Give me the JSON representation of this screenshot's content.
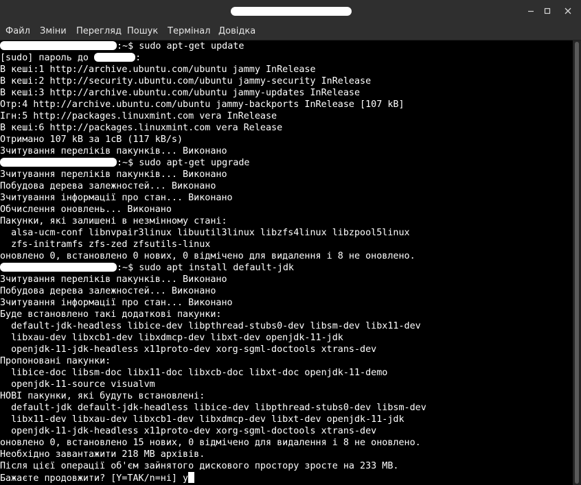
{
  "window": {
    "controls": {
      "minimize": "minimize-icon",
      "maximize": "maximize-icon",
      "close": "close-icon"
    }
  },
  "menu": {
    "items": [
      "Файл",
      "Зміни",
      "Перегляд",
      "Пошук",
      "Термінал",
      "Довідка"
    ]
  },
  "terminal": {
    "prompt_suffix": ":~$ ",
    "lines": [
      {
        "type": "prompt",
        "text": "sudo apt-get update"
      },
      {
        "type": "sudo",
        "before": "[sudo] пароль до ",
        "after": ":"
      },
      {
        "type": "text",
        "text": "В кеші:1 http://archive.ubuntu.com/ubuntu jammy InRelease"
      },
      {
        "type": "text",
        "text": "В кеші:2 http://security.ubuntu.com/ubuntu jammy-security InRelease"
      },
      {
        "type": "text",
        "text": "В кеші:3 http://archive.ubuntu.com/ubuntu jammy-updates InRelease"
      },
      {
        "type": "text",
        "text": "Отр:4 http://archive.ubuntu.com/ubuntu jammy-backports InRelease [107 kB]"
      },
      {
        "type": "text",
        "text": "Ігн:5 http://packages.linuxmint.com vera InRelease"
      },
      {
        "type": "text",
        "text": "В кеші:6 http://packages.linuxmint.com vera Release"
      },
      {
        "type": "text",
        "text": "Отримано 107 kB за 1сВ (117 kB/s)"
      },
      {
        "type": "text",
        "text": "Зчитування переліків пакунків... Виконано"
      },
      {
        "type": "prompt",
        "text": "sudo apt-get upgrade"
      },
      {
        "type": "text",
        "text": "Зчитування переліків пакунків... Виконано"
      },
      {
        "type": "text",
        "text": "Побудова дерева залежностей... Виконано"
      },
      {
        "type": "text",
        "text": "Зчитування інформації про стан... Виконано"
      },
      {
        "type": "text",
        "text": "Обчислення оновлень... Виконано"
      },
      {
        "type": "text",
        "text": "Пакунки, які залишені в незмінному стані:"
      },
      {
        "type": "text",
        "text": "  alsa-ucm-conf libnvpair3linux libuutil3linux libzfs4linux libzpool5linux"
      },
      {
        "type": "text",
        "text": "  zfs-initramfs zfs-zed zfsutils-linux"
      },
      {
        "type": "text",
        "text": "оновлено 0, встановлено 0 нових, 0 відмічено для видалення і 8 не оновлено."
      },
      {
        "type": "prompt",
        "text": "sudo apt install default-jdk"
      },
      {
        "type": "text",
        "text": "Зчитування переліків пакунків... Виконано"
      },
      {
        "type": "text",
        "text": "Побудова дерева залежностей... Виконано"
      },
      {
        "type": "text",
        "text": "Зчитування інформації про стан... Виконано"
      },
      {
        "type": "text",
        "text": "Буде встановлено такі додаткові пакунки:"
      },
      {
        "type": "text",
        "text": "  default-jdk-headless libice-dev libpthread-stubs0-dev libsm-dev libx11-dev"
      },
      {
        "type": "text",
        "text": "  libxau-dev libxcb1-dev libxdmcp-dev libxt-dev openjdk-11-jdk"
      },
      {
        "type": "text",
        "text": "  openjdk-11-jdk-headless x11proto-dev xorg-sgml-doctools xtrans-dev"
      },
      {
        "type": "text",
        "text": "Пропоновані пакунки:"
      },
      {
        "type": "text",
        "text": "  libice-doc libsm-doc libx11-doc libxcb-doc libxt-doc openjdk-11-demo"
      },
      {
        "type": "text",
        "text": "  openjdk-11-source visualvm"
      },
      {
        "type": "text",
        "text": "НОВІ пакунки, які будуть встановлені:"
      },
      {
        "type": "text",
        "text": "  default-jdk default-jdk-headless libice-dev libpthread-stubs0-dev libsm-dev"
      },
      {
        "type": "text",
        "text": "  libx11-dev libxau-dev libxcb1-dev libxdmcp-dev libxt-dev openjdk-11-jdk"
      },
      {
        "type": "text",
        "text": "  openjdk-11-jdk-headless x11proto-dev xorg-sgml-doctools xtrans-dev"
      },
      {
        "type": "text",
        "text": "оновлено 0, встановлено 15 нових, 0 відмічено для видалення і 8 не оновлено."
      },
      {
        "type": "text",
        "text": "Необхідно завантажити 218 MB архівів."
      },
      {
        "type": "text",
        "text": "Після цієї операції об'єм зайнятого дискового простору зросте на 233 MB."
      },
      {
        "type": "input",
        "text": "Бажаєте продовжити? [Y=ТАК/n=ні] ",
        "typed": "y"
      }
    ]
  }
}
